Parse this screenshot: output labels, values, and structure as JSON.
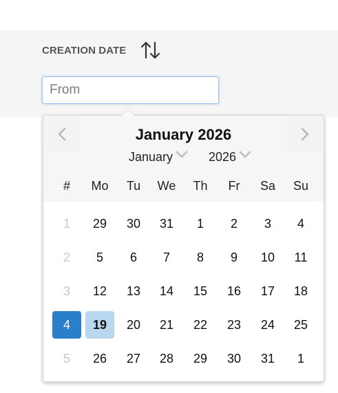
{
  "filter": {
    "label": "CREATION DATE",
    "input_placeholder": "From",
    "input_value": ""
  },
  "datepicker": {
    "title": "January 2026",
    "month_select": "January",
    "year_select": "2026",
    "prev_icon": "chevron-left-icon",
    "next_icon": "chevron-right-icon",
    "weekday_headers": [
      "#",
      "Mo",
      "Tu",
      "We",
      "Th",
      "Fr",
      "Sa",
      "Su"
    ],
    "weeks": [
      {
        "week": "1",
        "days": [
          "29",
          "30",
          "31",
          "1",
          "2",
          "3",
          "4"
        ]
      },
      {
        "week": "2",
        "days": [
          "5",
          "6",
          "7",
          "8",
          "9",
          "10",
          "11"
        ]
      },
      {
        "week": "3",
        "days": [
          "12",
          "13",
          "14",
          "15",
          "16",
          "17",
          "18"
        ]
      },
      {
        "week": "4",
        "days": [
          "19",
          "20",
          "21",
          "22",
          "23",
          "24",
          "25"
        ]
      },
      {
        "week": "5",
        "days": [
          "26",
          "27",
          "28",
          "29",
          "30",
          "31",
          "1"
        ]
      }
    ],
    "highlighted_week": "4",
    "selected_day": "19"
  },
  "colors": {
    "accent": "#2a7fc9",
    "selected_day_bg": "#b9d8f0",
    "muted_text": "#c8c8c8"
  }
}
